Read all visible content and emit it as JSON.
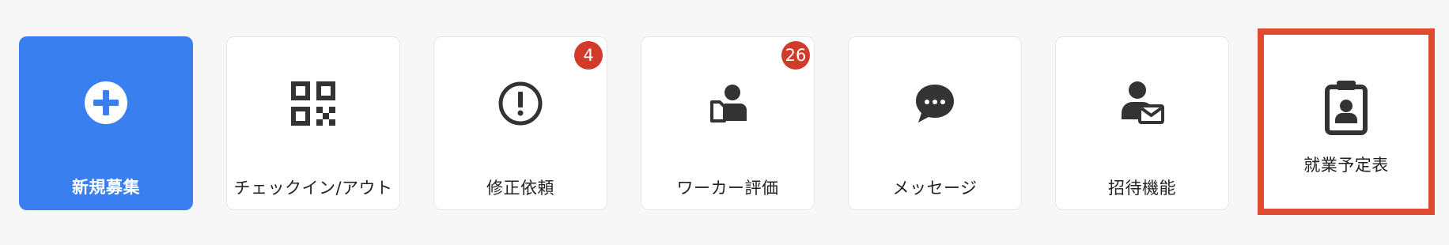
{
  "menu": {
    "items": [
      {
        "id": "new-recruit",
        "label": "新規募集",
        "icon": "plus-circle-icon",
        "variant": "primary",
        "badge": null
      },
      {
        "id": "check-in-out",
        "label": "チェックイン/アウト",
        "icon": "qr-code-icon",
        "variant": "default",
        "badge": null
      },
      {
        "id": "correction-requests",
        "label": "修正依頼",
        "icon": "alert-circle-icon",
        "variant": "default",
        "badge": "4"
      },
      {
        "id": "worker-rating",
        "label": "ワーカー評価",
        "icon": "worker-rating-icon",
        "variant": "default",
        "badge": "26"
      },
      {
        "id": "messages",
        "label": "メッセージ",
        "icon": "chat-bubble-icon",
        "variant": "default",
        "badge": null
      },
      {
        "id": "invite",
        "label": "招待機能",
        "icon": "user-mail-icon",
        "variant": "default",
        "badge": null
      },
      {
        "id": "work-schedule",
        "label": "就業予定表",
        "icon": "clipboard-user-icon",
        "variant": "highlighted",
        "badge": null
      }
    ]
  },
  "colors": {
    "primary": "#3a7ff0",
    "badge": "#d23a2a",
    "highlight_border": "#e04a32",
    "icon": "#333333",
    "background": "#f7f7f7"
  }
}
